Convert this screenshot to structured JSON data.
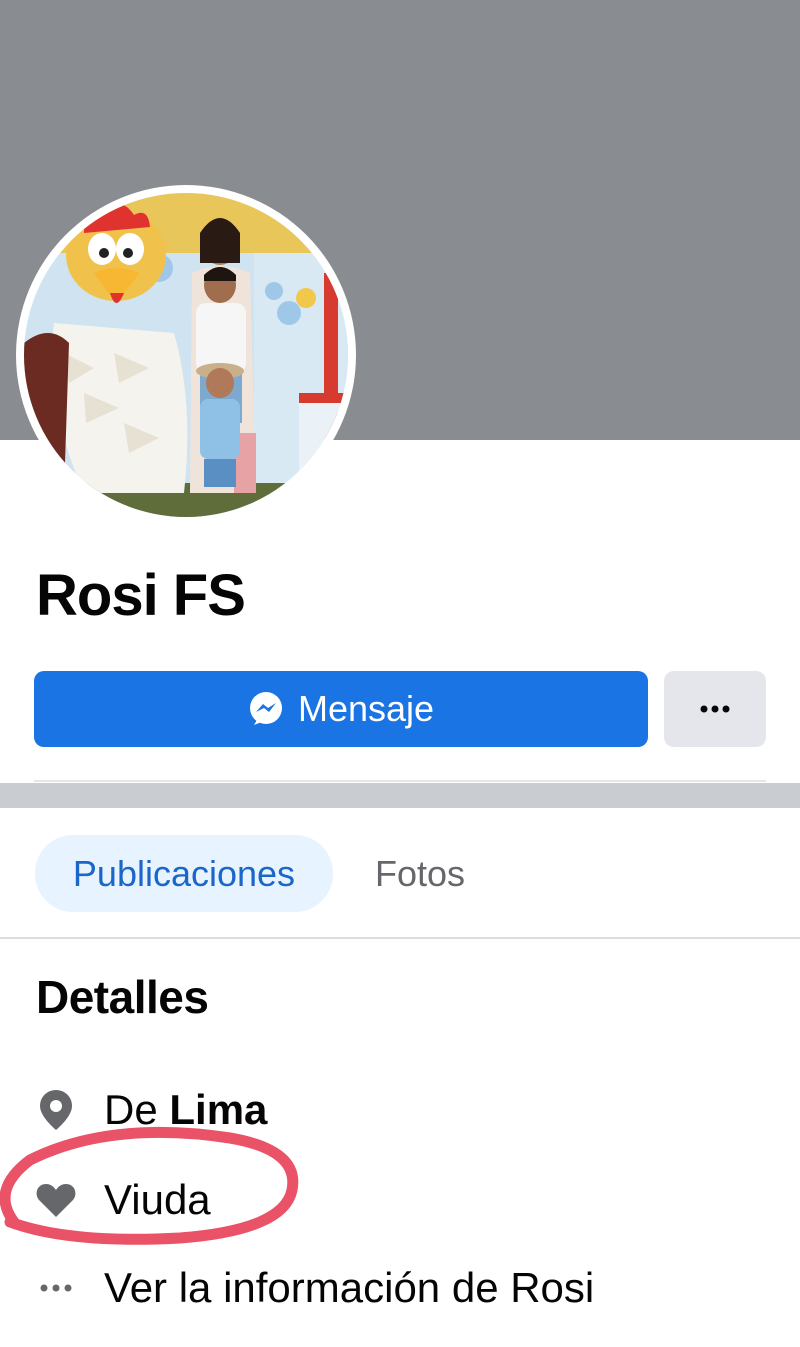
{
  "profile": {
    "name": "Rosi FS",
    "photo_alt": "profile-photo"
  },
  "actions": {
    "message_label": "Mensaje",
    "more_label": "•••"
  },
  "tabs": [
    {
      "label": "Publicaciones",
      "active": true
    },
    {
      "label": "Fotos",
      "active": false
    }
  ],
  "details": {
    "title": "Detalles",
    "from_prefix": "De",
    "from_city": "Lima",
    "relationship": "Viuda",
    "more_info": "Ver la información de Rosi",
    "more_icon": "•••"
  },
  "colors": {
    "accent": "#1b74e4",
    "cover": "#898c91",
    "annotation": "#e8435a"
  }
}
